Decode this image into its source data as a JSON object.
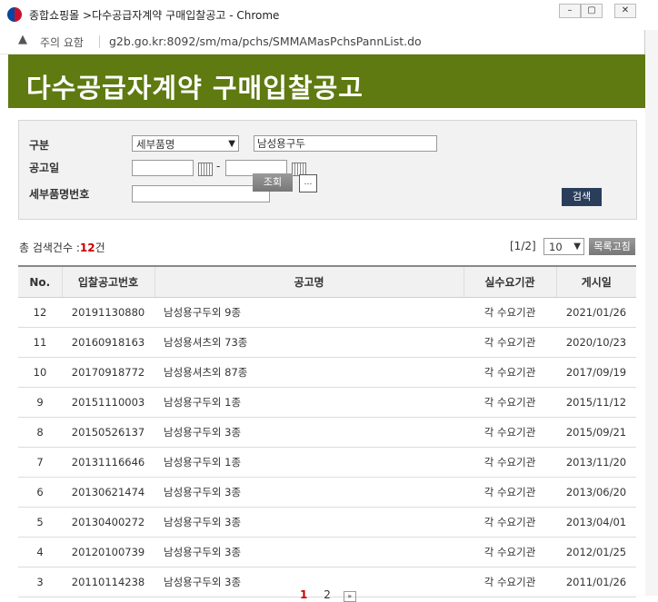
{
  "window": {
    "title": "종합쇼핑몰 >다수공급자계약 구매입찰공고 - Chrome",
    "minimize": "–",
    "restore": "▢",
    "close": "✕"
  },
  "address_bar": {
    "security_label": "주의 요함",
    "url": "g2b.go.kr:8092/sm/ma/pchs/SMMAMasPchsPannList.do"
  },
  "banner": {
    "title": "다수공급자계약 구매입찰공고"
  },
  "search": {
    "category_label": "구분",
    "category_selected": "세부품명",
    "category_value": "남성용구두",
    "date_label": "공고일",
    "date_from": "",
    "date_to": "",
    "date_separator": "-",
    "item_no_label": "세부품명번호",
    "item_no_value": "",
    "lookup_button": "조회",
    "search_button": "검색"
  },
  "results": {
    "count_prefix": "총 검색건수 :",
    "count": "12",
    "count_suffix": "건",
    "page_info": "[1/2]",
    "page_size": "10",
    "page_size_button": "목록고침"
  },
  "table": {
    "headers": [
      "No.",
      "입찰공고번호",
      "공고명",
      "실수요기관",
      "게시일"
    ],
    "rows": [
      [
        "12",
        "20191130880",
        "남성용구두외 9종",
        "각 수요기관",
        "2021/01/26"
      ],
      [
        "11",
        "20160918163",
        "남성용셔츠외 73종",
        "각 수요기관",
        "2020/10/23"
      ],
      [
        "10",
        "20170918772",
        "남성용셔츠외 87종",
        "각 수요기관",
        "2017/09/19"
      ],
      [
        "9",
        "20151110003",
        "남성용구두외 1종",
        "각 수요기관",
        "2015/11/12"
      ],
      [
        "8",
        "20150526137",
        "남성용구두외 3종",
        "각 수요기관",
        "2015/09/21"
      ],
      [
        "7",
        "20131116646",
        "남성용구두외 1종",
        "각 수요기관",
        "2013/11/20"
      ],
      [
        "6",
        "20130621474",
        "남성용구두외 3종",
        "각 수요기관",
        "2013/06/20"
      ],
      [
        "5",
        "20130400272",
        "남성용구두외 3종",
        "각 수요기관",
        "2013/04/01"
      ],
      [
        "4",
        "20120100739",
        "남성용구두외 3종",
        "각 수요기관",
        "2012/01/25"
      ],
      [
        "3",
        "20110114238",
        "남성용구두외 3종",
        "각 수요기관",
        "2011/01/26"
      ]
    ]
  },
  "pager": {
    "current": "1",
    "next_page": "2",
    "next_icon": "»"
  }
}
